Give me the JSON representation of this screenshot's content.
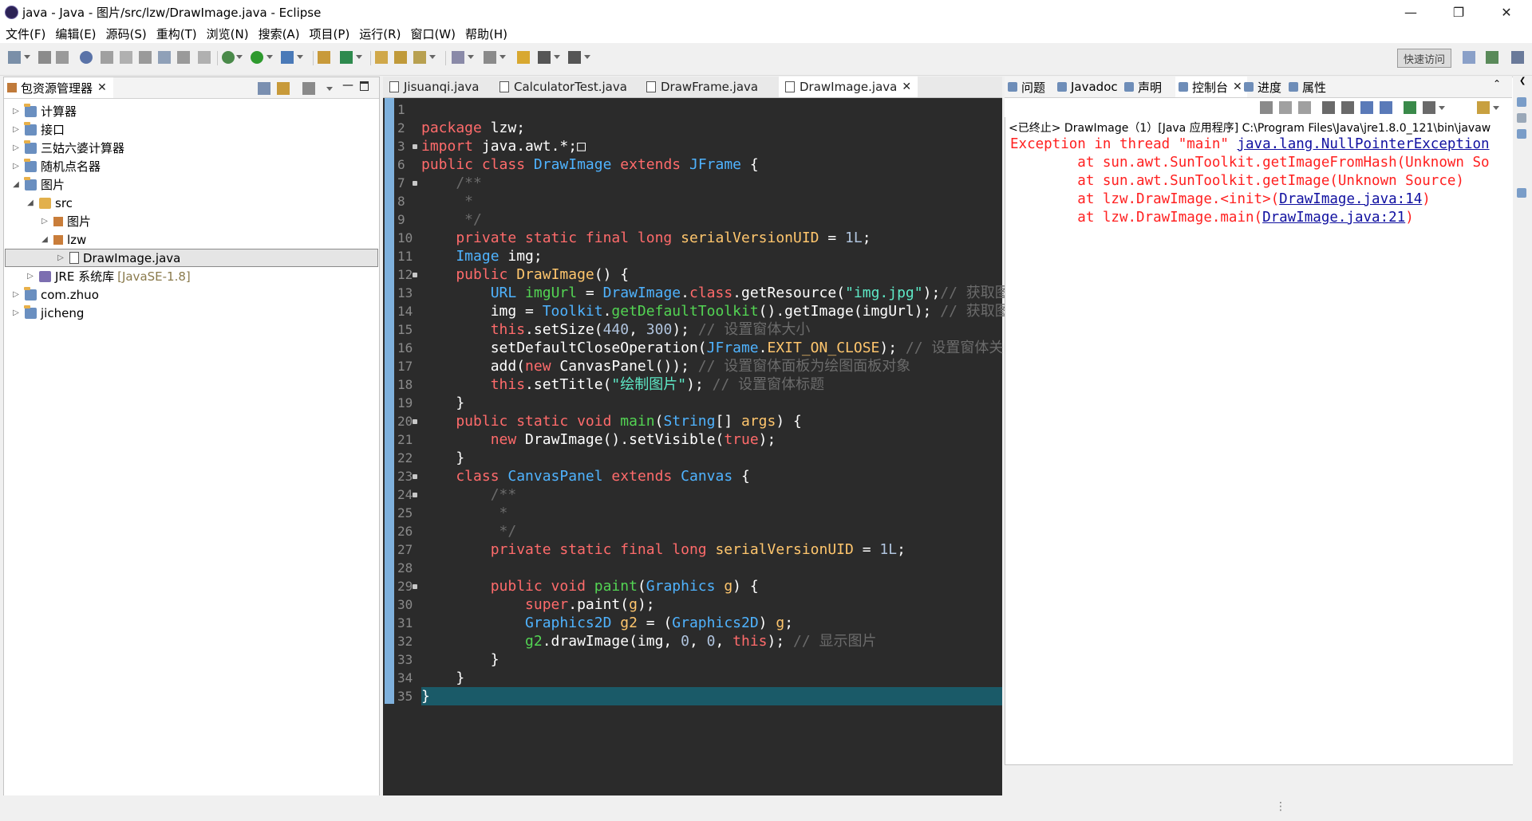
{
  "window": {
    "title": "java  -  Java  -  图片/src/lzw/DrawImage.java  -  Eclipse"
  },
  "menu": [
    "文件(F)",
    "编辑(E)",
    "源码(S)",
    "重构(T)",
    "浏览(N)",
    "搜索(A)",
    "项目(P)",
    "运行(R)",
    "窗口(W)",
    "帮助(H)"
  ],
  "toolbar": {
    "quick_access": "快速访问"
  },
  "package_explorer": {
    "title": "包资源管理器",
    "items": [
      {
        "label": "计算器",
        "indent": 0,
        "toggle": "▷",
        "icon": "proj"
      },
      {
        "label": "接口",
        "indent": 0,
        "toggle": "▷",
        "icon": "proj"
      },
      {
        "label": "三姑六婆计算器",
        "indent": 0,
        "toggle": "▷",
        "icon": "proj"
      },
      {
        "label": "随机点名器",
        "indent": 0,
        "toggle": "▷",
        "icon": "proj"
      },
      {
        "label": "图片",
        "indent": 0,
        "toggle": "◢",
        "icon": "proj"
      },
      {
        "label": "src",
        "indent": 1,
        "toggle": "◢",
        "icon": "src"
      },
      {
        "label": "图片",
        "indent": 2,
        "toggle": "▷",
        "icon": "pkg"
      },
      {
        "label": "lzw",
        "indent": 2,
        "toggle": "◢",
        "icon": "pkg"
      },
      {
        "label": "DrawImage.java",
        "indent": 3,
        "toggle": "▷",
        "icon": "java",
        "selected": true
      },
      {
        "label": "JRE 系统库",
        "extra": "[JavaSE-1.8]",
        "indent": 1,
        "toggle": "▷",
        "icon": "jre"
      },
      {
        "label": "com.zhuo",
        "indent": 0,
        "toggle": "▷",
        "icon": "proj"
      },
      {
        "label": "jicheng",
        "indent": 0,
        "toggle": "▷",
        "icon": "proj"
      }
    ]
  },
  "editor": {
    "tabs": [
      "Jisuanqi.java",
      "CalculatorTest.java",
      "DrawFrame.java",
      "DrawImage.java"
    ],
    "active_tab": 3,
    "lines": [
      {
        "n": "1",
        "fold": false,
        "segs": []
      },
      {
        "n": "2",
        "fold": false,
        "segs": [
          [
            "kw",
            "package"
          ],
          [
            "pl",
            " lzw;"
          ]
        ]
      },
      {
        "n": "3",
        "fold": true,
        "segs": [
          [
            "kw",
            "import"
          ],
          [
            "pl",
            " java.awt.*;"
          ],
          [
            "pl",
            "□"
          ]
        ]
      },
      {
        "n": "6",
        "fold": false,
        "segs": [
          [
            "kw",
            "public class "
          ],
          [
            "ty",
            "DrawImage"
          ],
          [
            "kw",
            " extends "
          ],
          [
            "ty",
            "JFrame"
          ],
          [
            "pl",
            " {"
          ]
        ]
      },
      {
        "n": "7",
        "fold": true,
        "segs": [
          [
            "cm",
            "    /**"
          ]
        ]
      },
      {
        "n": "8",
        "fold": false,
        "segs": [
          [
            "cm",
            "     *"
          ]
        ]
      },
      {
        "n": "9",
        "fold": false,
        "segs": [
          [
            "cm",
            "     */"
          ]
        ]
      },
      {
        "n": "10",
        "fold": false,
        "segs": [
          [
            "kw",
            "    private static final long "
          ],
          [
            "sv",
            "serialVersionUID"
          ],
          [
            "pl",
            " = "
          ],
          [
            "num",
            "1L"
          ],
          [
            "pl",
            ";"
          ]
        ]
      },
      {
        "n": "11",
        "fold": false,
        "segs": [
          [
            "ty",
            "    Image"
          ],
          [
            "pl",
            " img;"
          ]
        ]
      },
      {
        "n": "12",
        "fold": true,
        "segs": [
          [
            "kw",
            "    public "
          ],
          [
            "sv",
            "DrawImage"
          ],
          [
            "pl",
            "() {"
          ]
        ]
      },
      {
        "n": "13",
        "fold": false,
        "segs": [
          [
            "ty",
            "        URL"
          ],
          [
            "fn",
            " imgUrl"
          ],
          [
            "pl",
            " = "
          ],
          [
            "ty",
            "DrawImage"
          ],
          [
            "pl",
            "."
          ],
          [
            "kw",
            "class"
          ],
          [
            "pl",
            ".getResource("
          ],
          [
            "str",
            "\"img.jpg\""
          ],
          [
            "pl",
            ");"
          ],
          [
            "cm",
            "// 获取图"
          ]
        ]
      },
      {
        "n": "14",
        "fold": false,
        "segs": [
          [
            "pl",
            "        img = "
          ],
          [
            "ty",
            "Toolkit"
          ],
          [
            "pl",
            "."
          ],
          [
            "fn",
            "getDefaultToolkit"
          ],
          [
            "pl",
            "().getImage(imgUrl); "
          ],
          [
            "cm",
            "// 获取图"
          ]
        ]
      },
      {
        "n": "15",
        "fold": false,
        "segs": [
          [
            "kw",
            "        this"
          ],
          [
            "pl",
            ".setSize("
          ],
          [
            "num",
            "440"
          ],
          [
            "pl",
            ", "
          ],
          [
            "num",
            "300"
          ],
          [
            "pl",
            "); "
          ],
          [
            "cm",
            "// 设置窗体大小"
          ]
        ]
      },
      {
        "n": "16",
        "fold": false,
        "segs": [
          [
            "pl",
            "        setDefaultCloseOperation("
          ],
          [
            "ty",
            "JFrame"
          ],
          [
            "pl",
            "."
          ],
          [
            "sv",
            "EXIT_ON_CLOSE"
          ],
          [
            "pl",
            "); "
          ],
          [
            "cm",
            "// 设置窗体关闭"
          ]
        ]
      },
      {
        "n": "17",
        "fold": false,
        "segs": [
          [
            "pl",
            "        add("
          ],
          [
            "kw",
            "new"
          ],
          [
            "pl",
            " CanvasPanel()); "
          ],
          [
            "cm",
            "// 设置窗体面板为绘图面板对象"
          ]
        ]
      },
      {
        "n": "18",
        "fold": false,
        "segs": [
          [
            "kw",
            "        this"
          ],
          [
            "pl",
            ".setTitle("
          ],
          [
            "str",
            "\"绘制图片\""
          ],
          [
            "pl",
            "); "
          ],
          [
            "cm",
            "// 设置窗体标题"
          ]
        ]
      },
      {
        "n": "19",
        "fold": false,
        "segs": [
          [
            "pl",
            "    }"
          ]
        ]
      },
      {
        "n": "20",
        "fold": true,
        "segs": [
          [
            "kw",
            "    public static void "
          ],
          [
            "fn",
            "main"
          ],
          [
            "pl",
            "("
          ],
          [
            "ty",
            "String"
          ],
          [
            "pl",
            "[] "
          ],
          [
            "sv",
            "args"
          ],
          [
            "pl",
            ") {"
          ]
        ]
      },
      {
        "n": "21",
        "fold": false,
        "segs": [
          [
            "kw",
            "        new"
          ],
          [
            "pl",
            " DrawImage().setVisible("
          ],
          [
            "kw",
            "true"
          ],
          [
            "pl",
            ");"
          ]
        ]
      },
      {
        "n": "22",
        "fold": false,
        "segs": [
          [
            "pl",
            "    }"
          ]
        ]
      },
      {
        "n": "23",
        "fold": true,
        "segs": [
          [
            "kw",
            "    class "
          ],
          [
            "ty",
            "CanvasPanel"
          ],
          [
            "kw",
            " extends "
          ],
          [
            "ty",
            "Canvas"
          ],
          [
            "pl",
            " {"
          ]
        ]
      },
      {
        "n": "24",
        "fold": true,
        "segs": [
          [
            "cm",
            "        /**"
          ]
        ]
      },
      {
        "n": "25",
        "fold": false,
        "segs": [
          [
            "cm",
            "         *"
          ]
        ]
      },
      {
        "n": "26",
        "fold": false,
        "segs": [
          [
            "cm",
            "         */"
          ]
        ]
      },
      {
        "n": "27",
        "fold": false,
        "segs": [
          [
            "kw",
            "        private static final long "
          ],
          [
            "sv",
            "serialVersionUID"
          ],
          [
            "pl",
            " = "
          ],
          [
            "num",
            "1L"
          ],
          [
            "pl",
            ";"
          ]
        ]
      },
      {
        "n": "28",
        "fold": false,
        "segs": []
      },
      {
        "n": "29",
        "fold": true,
        "segs": [
          [
            "kw",
            "        public void "
          ],
          [
            "fn",
            "paint"
          ],
          [
            "pl",
            "("
          ],
          [
            "ty",
            "Graphics"
          ],
          [
            "sv",
            " g"
          ],
          [
            "pl",
            ") {"
          ]
        ]
      },
      {
        "n": "30",
        "fold": false,
        "segs": [
          [
            "kw",
            "            super"
          ],
          [
            "pl",
            ".paint("
          ],
          [
            "sv",
            "g"
          ],
          [
            "pl",
            ");"
          ]
        ]
      },
      {
        "n": "31",
        "fold": false,
        "segs": [
          [
            "ty",
            "            Graphics2D"
          ],
          [
            "sv",
            " g2"
          ],
          [
            "pl",
            " = ("
          ],
          [
            "ty",
            "Graphics2D"
          ],
          [
            "pl",
            ") "
          ],
          [
            "sv",
            "g"
          ],
          [
            "pl",
            ";"
          ]
        ]
      },
      {
        "n": "32",
        "fold": false,
        "segs": [
          [
            "fn",
            "            g2"
          ],
          [
            "pl",
            ".drawImage(img, "
          ],
          [
            "num",
            "0"
          ],
          [
            "pl",
            ", "
          ],
          [
            "num",
            "0"
          ],
          [
            "pl",
            ", "
          ],
          [
            "kw",
            "this"
          ],
          [
            "pl",
            "); "
          ],
          [
            "cm",
            "// 显示图片"
          ]
        ]
      },
      {
        "n": "33",
        "fold": false,
        "segs": [
          [
            "pl",
            "        }"
          ]
        ]
      },
      {
        "n": "34",
        "fold": false,
        "segs": [
          [
            "pl",
            "    }"
          ]
        ]
      },
      {
        "n": "35",
        "fold": false,
        "segs": [
          [
            "pl",
            "}"
          ]
        ],
        "highlight": true
      }
    ]
  },
  "console": {
    "tabs": [
      {
        "label": "问题"
      },
      {
        "label": "Javadoc"
      },
      {
        "label": "声明"
      },
      {
        "label": "控制台",
        "active": true
      },
      {
        "label": "进度"
      },
      {
        "label": "属性"
      }
    ],
    "header": "<已终止> DrawImage（1）[Java 应用程序] C:\\Program Files\\Java\\jre1.8.0_121\\bin\\javaw",
    "lines": [
      {
        "pre": "Exception in thread \"main\" ",
        "link": "java.lang.NullPointerException",
        "post": ""
      },
      {
        "pre": "\tat sun.awt.SunToolkit.getImageFromHash(Unknown So",
        "link": "",
        "post": ""
      },
      {
        "pre": "\tat sun.awt.SunToolkit.getImage(Unknown Source)",
        "link": "",
        "post": ""
      },
      {
        "pre": "\tat lzw.DrawImage.<init>(",
        "link": "DrawImage.java:14",
        "post": ")"
      },
      {
        "pre": "\tat lzw.DrawImage.main(",
        "link": "DrawImage.java:21",
        "post": ")"
      }
    ]
  }
}
